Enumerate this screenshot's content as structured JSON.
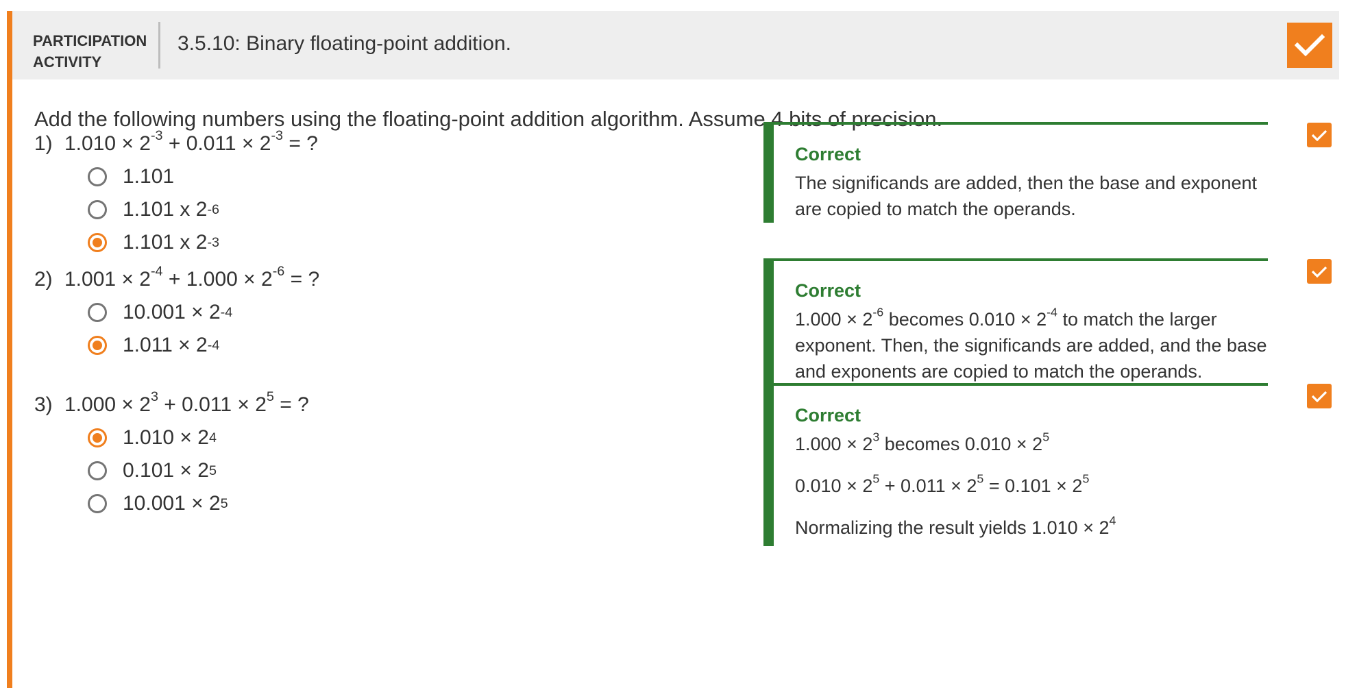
{
  "header": {
    "type_line1": "PARTICIPATION",
    "type_line2": "ACTIVITY",
    "title": "3.5.10: Binary floating-point addition."
  },
  "instructions": "Add the following numbers using the floating-point addition algorithm. Assume 4 bits of precision.",
  "questions": [
    {
      "number": "1)",
      "prompt": {
        "a": "1.010 × 2",
        "a_exp": "-3",
        "b": " + 0.011 × 2",
        "b_exp": "-3",
        "end": " = ?"
      },
      "options": [
        {
          "base": "1.101",
          "exp": "",
          "selected": false
        },
        {
          "base": "1.101 x 2",
          "exp": "-6",
          "selected": false
        },
        {
          "base": "1.101 x 2",
          "exp": "-3",
          "selected": true
        }
      ],
      "feedback": {
        "title": "Correct",
        "text": "The significands are added, then the base and exponent are copied to match the operands."
      }
    },
    {
      "number": "2)",
      "prompt": {
        "a": "1.001 × 2",
        "a_exp": "-4",
        "b": " + 1.000 × 2",
        "b_exp": "-6",
        "end": " = ?"
      },
      "options": [
        {
          "base": "10.001 × 2",
          "exp": "-4",
          "selected": false
        },
        {
          "base": "1.011 × 2",
          "exp": "-4",
          "selected": true
        }
      ],
      "feedback": {
        "title": "Correct",
        "text_a": "1.000 × 2",
        "text_a_exp": "-6",
        "text_b": " becomes 0.010 × 2",
        "text_b_exp": "-4",
        "text_c": " to match the larger exponent. Then, the significands are added, and the base and exponents are copied to match the operands."
      }
    },
    {
      "number": "3)",
      "prompt": {
        "a": "1.000 × 2",
        "a_exp": "3",
        "b": " + 0.011 × 2",
        "b_exp": "5",
        "end": " = ?"
      },
      "options": [
        {
          "base": "1.010 × 2",
          "exp": "4",
          "selected": true
        },
        {
          "base": "0.101 × 2",
          "exp": "5",
          "selected": false
        },
        {
          "base": "10.001 × 2",
          "exp": "5",
          "selected": false
        }
      ],
      "feedback": {
        "title": "Correct",
        "line1_a": "1.000 × 2",
        "line1_a_exp": "3",
        "line1_b": " becomes 0.010 × 2",
        "line1_b_exp": "5",
        "line2_a": "0.010 × 2",
        "line2_a_exp": "5",
        "line2_b": " + 0.011 × 2",
        "line2_b_exp": "5",
        "line2_c": " = 0.101 × 2",
        "line2_c_exp": "5",
        "line3_a": "Normalizing the result yields 1.010 × 2",
        "line3_a_exp": "4"
      }
    }
  ],
  "colors": {
    "accent": "#f07f1e",
    "correct": "#2e7d32",
    "header_bg": "#eeeeee",
    "text": "#333333"
  },
  "icons": {
    "completion": "checkmark-icon"
  }
}
